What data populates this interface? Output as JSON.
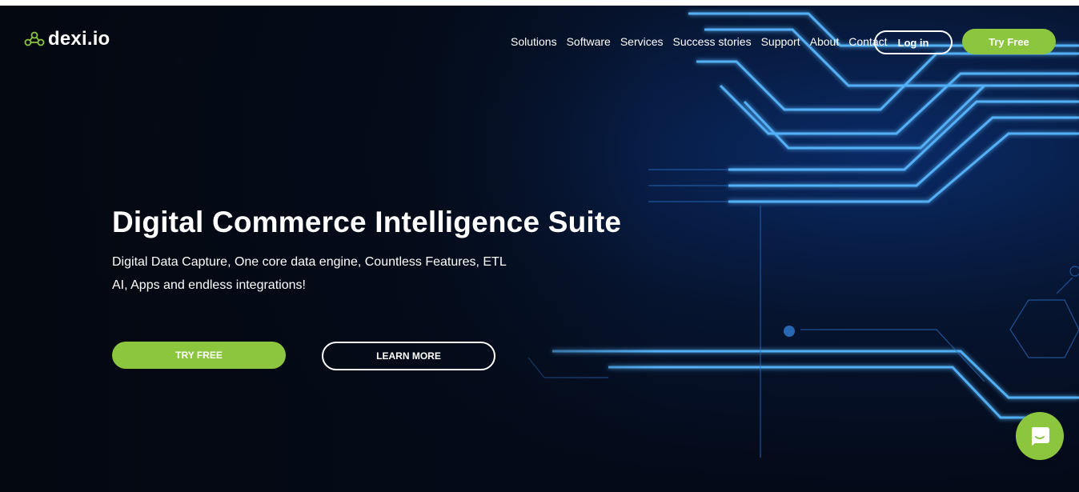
{
  "brand": {
    "name": "dexi.io",
    "icon": "molecule-logo-icon",
    "accent": "#8cc63f"
  },
  "nav": {
    "items": [
      {
        "label": "Solutions"
      },
      {
        "label": "Software"
      },
      {
        "label": "Services"
      },
      {
        "label": "Success stories"
      },
      {
        "label": "Support"
      },
      {
        "label": "About"
      },
      {
        "label": "Contact"
      }
    ],
    "login_label": "Log in",
    "try_free_label": "Try Free"
  },
  "hero": {
    "title": "Digital Commerce Intelligence Suite",
    "subtitle_line1": "Digital Data Capture, One core data engine, Countless Features, ETL",
    "subtitle_line2": "AI, Apps and endless integrations!",
    "primary_cta": "TRY FREE",
    "secondary_cta": "LEARN MORE"
  },
  "chat": {
    "icon": "chat-bubble-icon"
  },
  "colors": {
    "background": "#040a18",
    "glow": "#3fa9ff",
    "button_green": "#8cc63f"
  }
}
